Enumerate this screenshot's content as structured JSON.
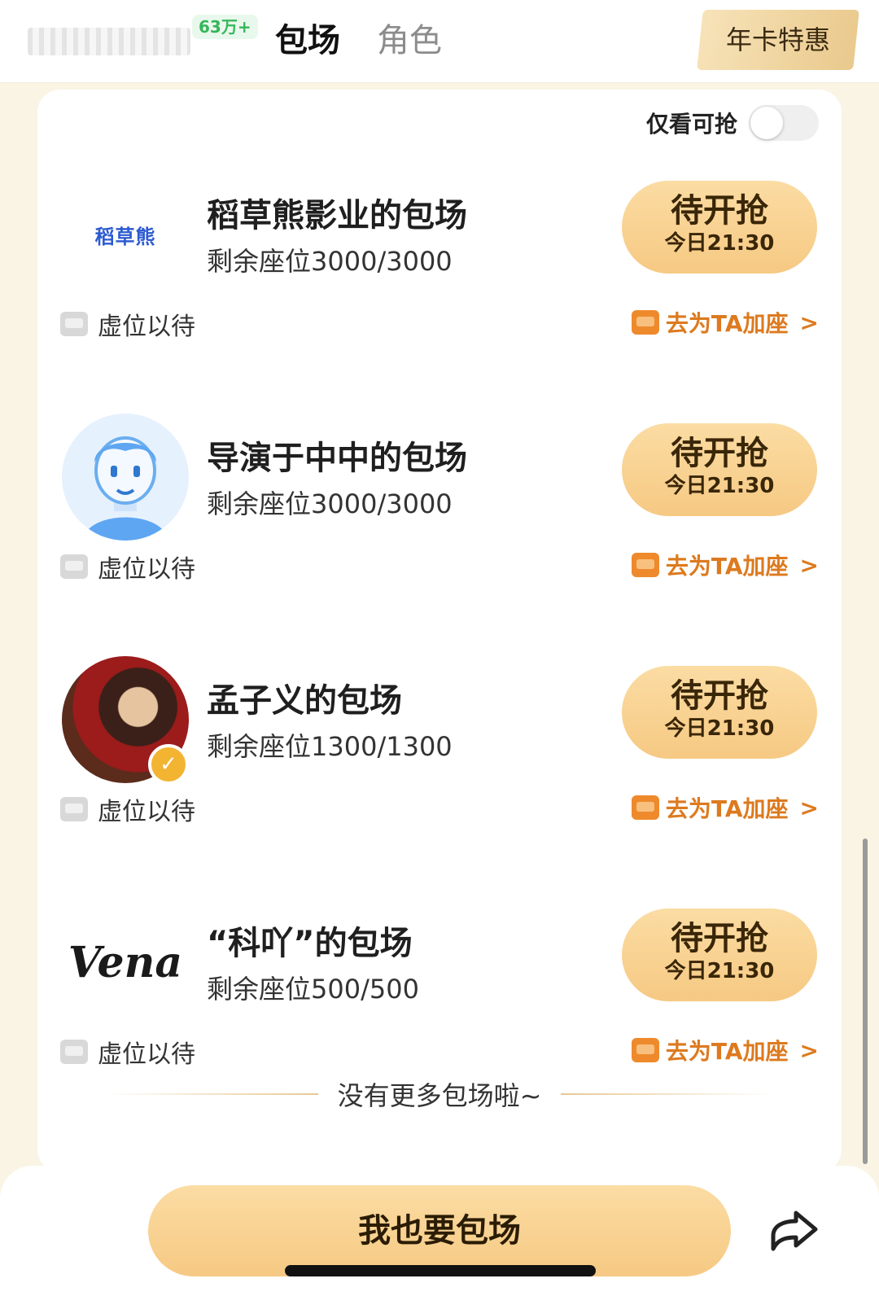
{
  "header": {
    "follower_count": "63万+",
    "tabs": [
      {
        "label": "包场",
        "active": true
      },
      {
        "label": "角色",
        "active": false
      }
    ],
    "promo_label": "年卡特惠"
  },
  "filter": {
    "label": "仅看可抢",
    "enabled": false
  },
  "entries": [
    {
      "avatar": "稻草熊",
      "title": "稻草熊影业的包场",
      "seats": "剩余座位3000/3000",
      "button_main": "待开抢",
      "button_time": "今日21:30",
      "seat_status": "虚位以待",
      "add_seat": "去为TA加座",
      "chevron": ">"
    },
    {
      "avatar": "",
      "title": "导演于中中的包场",
      "seats": "剩余座位3000/3000",
      "button_main": "待开抢",
      "button_time": "今日21:30",
      "seat_status": "虚位以待",
      "add_seat": "去为TA加座",
      "chevron": ">"
    },
    {
      "avatar": "",
      "title": "孟子义的包场",
      "seats": "剩余座位1300/1300",
      "button_main": "待开抢",
      "button_time": "今日21:30",
      "seat_status": "虚位以待",
      "add_seat": "去为TA加座",
      "chevron": ">"
    },
    {
      "avatar": "Vena",
      "title": "“科吖”的包场",
      "seats": "剩余座位500/500",
      "button_main": "待开抢",
      "button_time": "今日21:30",
      "seat_status": "虚位以待",
      "add_seat": "去为TA加座",
      "chevron": ">"
    }
  ],
  "footer_note": "没有更多包场啦~",
  "cta_label": "我也要包场",
  "icons": {
    "share": "share-icon",
    "verified": "verified-badge-icon",
    "seat_empty": "seat-gray-icon",
    "seat_add": "seat-orange-icon"
  },
  "colors": {
    "accent": "#f6c983",
    "add_seat_text": "#dd7a1f",
    "count_badge": "#34b65a"
  }
}
